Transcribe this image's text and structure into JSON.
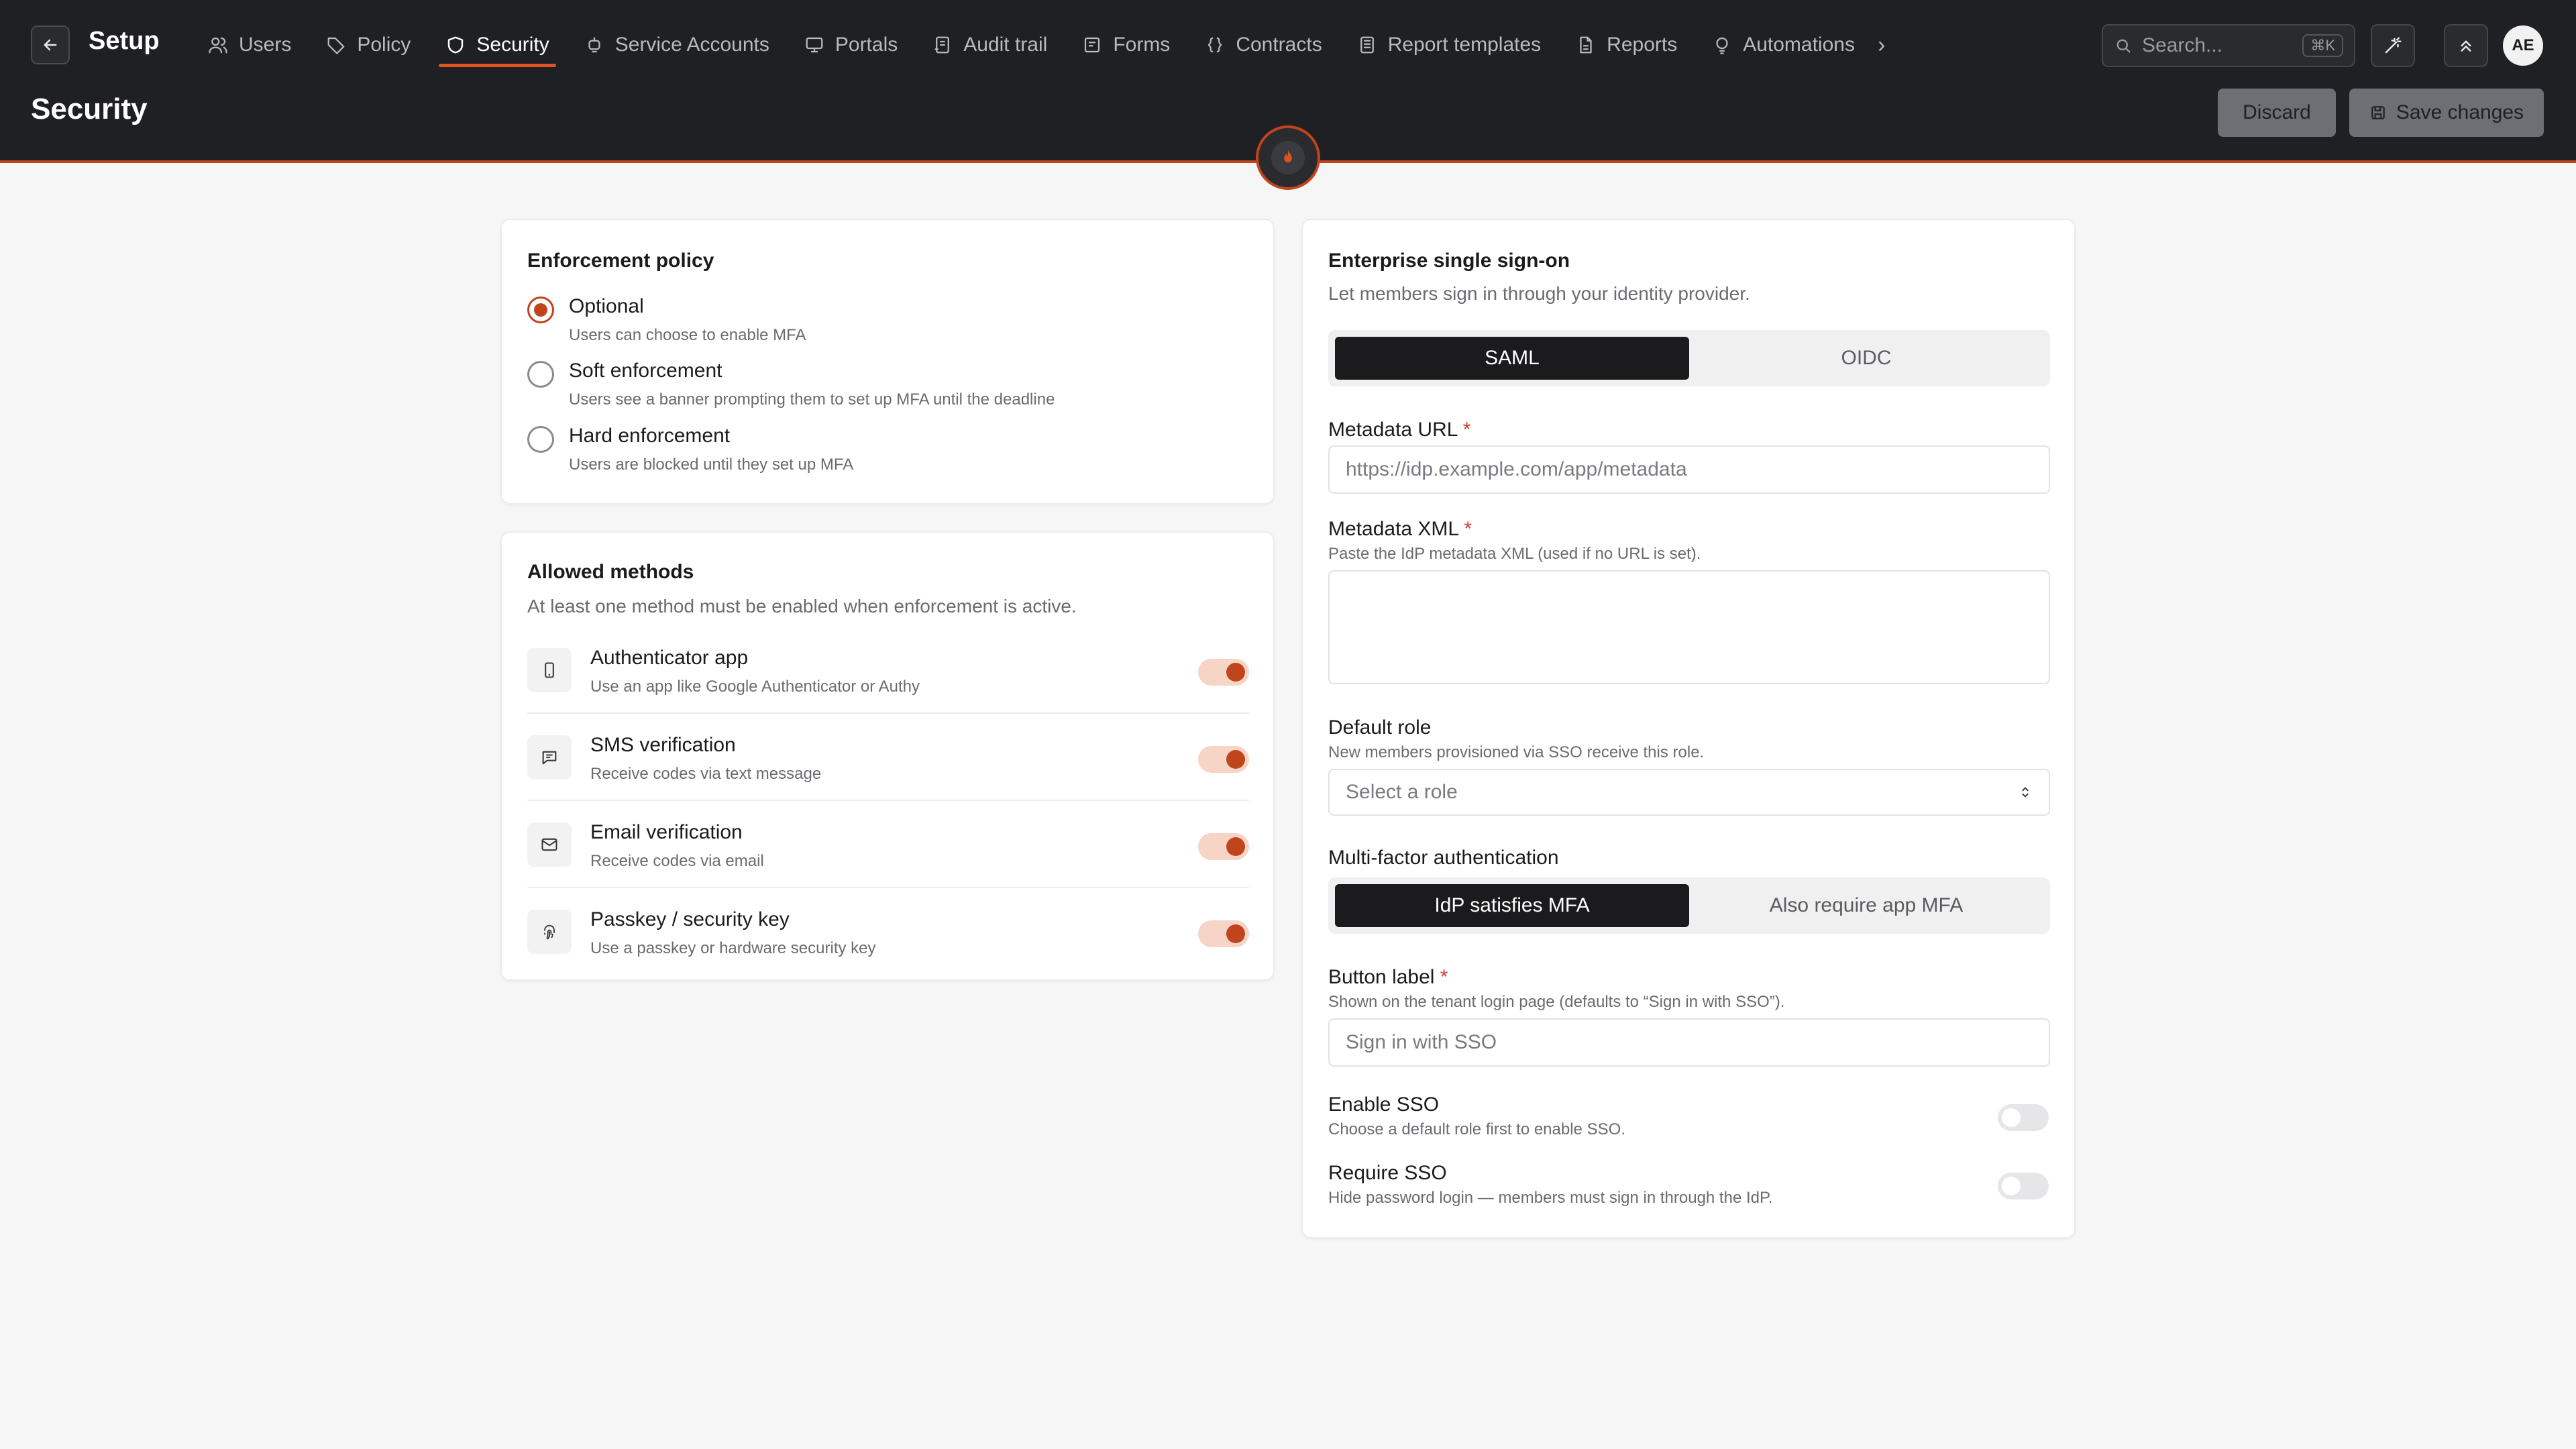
{
  "header": {
    "app_title": "Setup",
    "page_title": "Security",
    "tabs": [
      {
        "label": "Users",
        "icon": "users-icon"
      },
      {
        "label": "Policy",
        "icon": "tag-icon"
      },
      {
        "label": "Security",
        "icon": "shield-icon",
        "active": true
      },
      {
        "label": "Service Accounts",
        "icon": "robot-icon"
      },
      {
        "label": "Portals",
        "icon": "monitor-icon"
      },
      {
        "label": "Audit trail",
        "icon": "history-icon"
      },
      {
        "label": "Forms",
        "icon": "form-icon"
      },
      {
        "label": "Contracts",
        "icon": "braces-icon"
      },
      {
        "label": "Report templates",
        "icon": "template-icon"
      },
      {
        "label": "Reports",
        "icon": "file-icon"
      },
      {
        "label": "Automations",
        "icon": "bulb-icon"
      }
    ],
    "search_placeholder": "Search...",
    "search_shortcut": "⌘K",
    "avatar_initials": "AE",
    "discard_label": "Discard",
    "save_label": "Save changes",
    "accent_color": "#e0521f"
  },
  "enforcement": {
    "title": "Enforcement policy",
    "options": [
      {
        "label": "Optional",
        "desc": "Users can choose to enable MFA",
        "selected": true
      },
      {
        "label": "Soft enforcement",
        "desc": "Users see a banner prompting them to set up MFA until the deadline",
        "selected": false
      },
      {
        "label": "Hard enforcement",
        "desc": "Users are blocked until they set up MFA",
        "selected": false
      }
    ]
  },
  "methods": {
    "title": "Allowed methods",
    "subtitle": "At least one method must be enabled when enforcement is active.",
    "items": [
      {
        "label": "Authenticator app",
        "desc": "Use an app like Google Authenticator or Authy",
        "icon": "phone-icon",
        "enabled": true
      },
      {
        "label": "SMS verification",
        "desc": "Receive codes via text message",
        "icon": "message-icon",
        "enabled": true
      },
      {
        "label": "Email verification",
        "desc": "Receive codes via email",
        "icon": "mail-icon",
        "enabled": true
      },
      {
        "label": "Passkey / security key",
        "desc": "Use a passkey or hardware security key",
        "icon": "fingerprint-icon",
        "enabled": true
      }
    ]
  },
  "sso": {
    "title": "Enterprise single sign-on",
    "subtitle": "Let members sign in through your identity provider.",
    "protocol_tabs": [
      "SAML",
      "OIDC"
    ],
    "metadata_url_label": "Metadata URL",
    "metadata_url_placeholder": "https://idp.example.com/app/metadata",
    "metadata_xml_label": "Metadata XML",
    "metadata_xml_hint": "Paste the IdP metadata XML (used if no URL is set).",
    "default_role_label": "Default role",
    "default_role_hint": "New members provisioned via SSO receive this role.",
    "default_role_placeholder": "Select a role",
    "mfa_label": "Multi-factor authentication",
    "mfa_tabs": [
      "IdP satisfies MFA",
      "Also require app MFA"
    ],
    "button_label_label": "Button label",
    "button_label_hint": "Shown on the tenant login page (defaults to “Sign in with SSO”).",
    "button_label_placeholder": "Sign in with SSO",
    "enable_label": "Enable SSO",
    "enable_hint": "Choose a default role first to enable SSO.",
    "enable_on": false,
    "require_label": "Require SSO",
    "require_hint": "Hide password login — members must sign in through the IdP.",
    "require_on": false
  }
}
